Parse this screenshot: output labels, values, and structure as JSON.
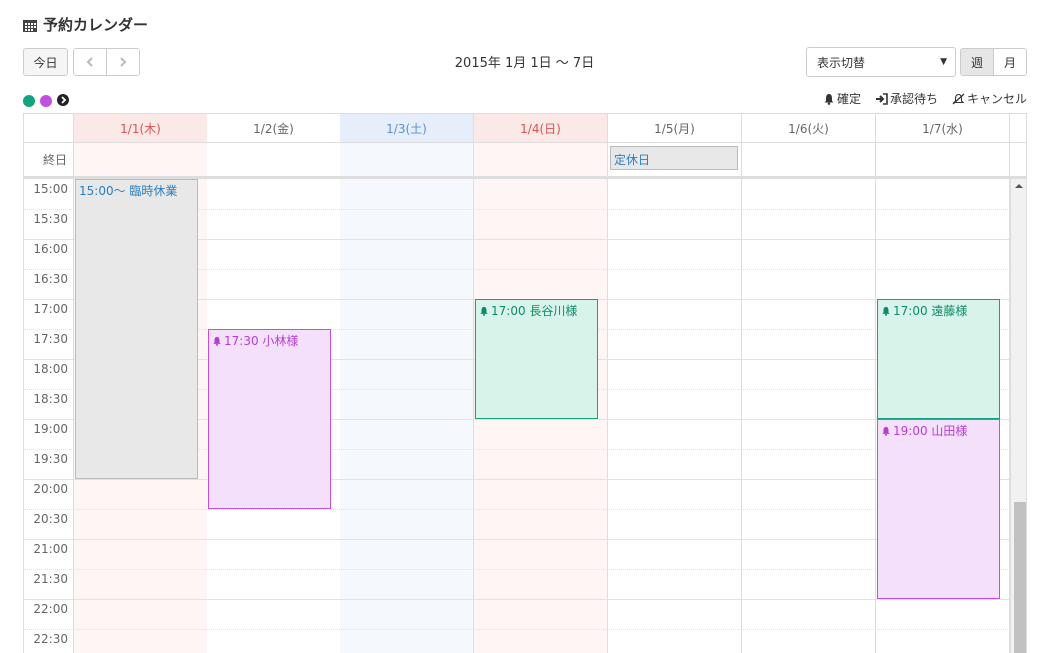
{
  "header": {
    "title": "予約カレンダー",
    "icon": "calendar-icon"
  },
  "toolbar": {
    "today_label": "今日",
    "prev_icon": "chevron-left-icon",
    "next_icon": "chevron-right-icon",
    "date_range": "2015年 1月 1日 〜 7日",
    "view_select_value": "表示切替",
    "week_label": "週",
    "month_label": "月"
  },
  "dots": [
    {
      "name": "filter-dot-green",
      "color": "#14a37f"
    },
    {
      "name": "filter-dot-purple",
      "color": "#c34fe0"
    },
    {
      "name": "next-circle-icon",
      "color": "#222222"
    }
  ],
  "legend": {
    "confirmed": "確定",
    "pending": "承認待ち",
    "cancel": "キャンセル"
  },
  "colors": {
    "holiday_red": "#d9534f",
    "saturday_blue": "#5b8fd6",
    "green_event_bg": "#d8f3ea",
    "green_event_border": "#14a37f",
    "purple_event_bg": "#f5e0fb",
    "purple_event_border": "#c34fe0"
  },
  "days": [
    {
      "label": "1/1(木)",
      "type": "holiday"
    },
    {
      "label": "1/2(金)",
      "type": "normal"
    },
    {
      "label": "1/3(土)",
      "type": "saturday"
    },
    {
      "label": "1/4(日)",
      "type": "holiday"
    },
    {
      "label": "1/5(月)",
      "type": "normal"
    },
    {
      "label": "1/6(火)",
      "type": "normal"
    },
    {
      "label": "1/7(水)",
      "type": "normal"
    }
  ],
  "allday": {
    "label": "終日",
    "events": [
      {
        "day": 4,
        "title": "定休日"
      }
    ]
  },
  "times": [
    "15:00",
    "15:30",
    "16:00",
    "16:30",
    "17:00",
    "17:30",
    "18:00",
    "18:30",
    "19:00",
    "19:30",
    "20:00",
    "20:30",
    "21:00",
    "21:30",
    "22:00",
    "22:30"
  ],
  "events": [
    {
      "day": 0,
      "start": "15:00",
      "end": "20:00",
      "title": "15:00〜 臨時休業",
      "style": "closed",
      "bell": false
    },
    {
      "day": 1,
      "start": "17:30",
      "end": "20:30",
      "title": "17:30 小林様",
      "style": "purple",
      "bell": true
    },
    {
      "day": 3,
      "start": "17:00",
      "end": "19:00",
      "title": "17:00 長谷川様",
      "style": "green",
      "bell": true
    },
    {
      "day": 6,
      "start": "17:00",
      "end": "19:00",
      "title": "17:00 遠藤様",
      "style": "green",
      "bell": true
    },
    {
      "day": 6,
      "start": "19:00",
      "end": "22:00",
      "title": "19:00 山田様",
      "style": "purple",
      "bell": true
    }
  ],
  "scroll": {
    "thumb_start": 0.67,
    "thumb_end": 1.0
  }
}
